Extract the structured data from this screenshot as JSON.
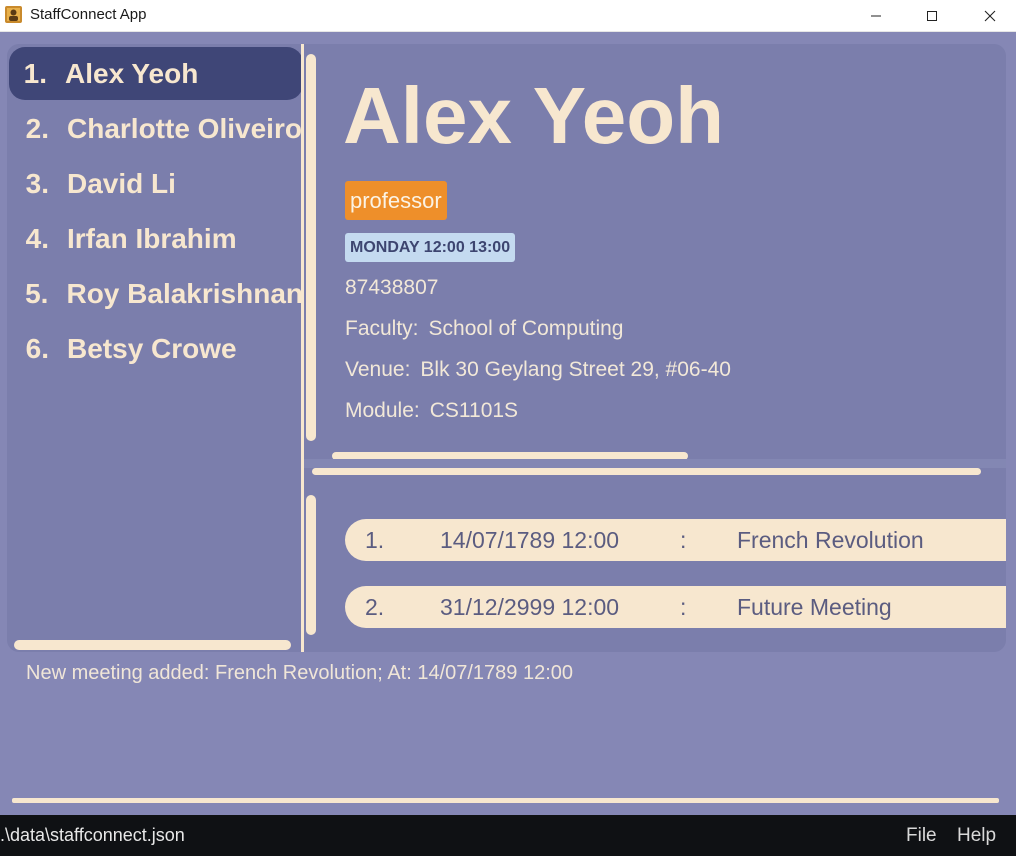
{
  "window": {
    "title": "StaffConnect App",
    "icons": [
      "app-icon",
      "minimize-icon",
      "maximize-icon",
      "close-icon"
    ]
  },
  "staff_list": {
    "selected_index": 0,
    "items": [
      {
        "index": "1.",
        "name": "Alex Yeoh"
      },
      {
        "index": "2.",
        "name": "Charlotte Oliveiro"
      },
      {
        "index": "3.",
        "name": "David Li"
      },
      {
        "index": "4.",
        "name": "Irfan Ibrahim"
      },
      {
        "index": "5.",
        "name": "Roy Balakrishnan"
      },
      {
        "index": "6.",
        "name": "Betsy Crowe"
      }
    ]
  },
  "details": {
    "name": "Alex Yeoh",
    "tag": "professor",
    "availability": "MONDAY 12:00 13:00",
    "phone": "87438807",
    "faculty_label": "Faculty:",
    "faculty": "School of Computing",
    "venue_label": "Venue:",
    "venue": "Blk 30 Geylang Street 29, #06-40",
    "module_label": "Module:",
    "module": "CS1101S"
  },
  "meetings": [
    {
      "index": "1.",
      "datetime": "14/07/1789 12:00",
      "separator": ":",
      "description": "French Revolution"
    },
    {
      "index": "2.",
      "datetime": "31/12/2999 12:00",
      "separator": ":",
      "description": "Future Meeting"
    }
  ],
  "result": {
    "message": "New meeting added: French Revolution; At: 14/07/1789 12:00"
  },
  "status_bar": {
    "path": ".\\data\\staffconnect.json",
    "menu": {
      "file": "File",
      "help": "Help"
    }
  },
  "colors": {
    "background": "#8587b5",
    "panel": "#7b7eac",
    "selected_item": "#3f4677",
    "cream": "#f7e7cf",
    "tag_role": "#ee8f2a",
    "tag_availability": "#c4daf0",
    "status_bar": "#0f1114"
  }
}
